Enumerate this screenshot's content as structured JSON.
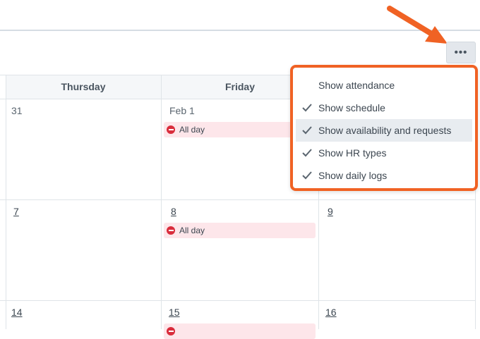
{
  "toolbar": {
    "more_label": "•••"
  },
  "calendar": {
    "headers": {
      "thursday": "Thursday",
      "friday": "Friday"
    },
    "rows": [
      {
        "thu": "31",
        "fri": "Feb 1"
      },
      {
        "thu": "7",
        "fri": "8",
        "sat": "9"
      },
      {
        "thu": "14",
        "fri": "15",
        "sat": "16"
      }
    ],
    "event_label": "All day"
  },
  "menu": {
    "items": [
      {
        "label": "Show attendance",
        "checked": false
      },
      {
        "label": "Show schedule",
        "checked": true
      },
      {
        "label": "Show availability and requests",
        "checked": true
      },
      {
        "label": "Show HR types",
        "checked": true
      },
      {
        "label": "Show daily logs",
        "checked": true
      }
    ]
  },
  "colors": {
    "highlight": "#f06224",
    "event_bg": "#fde6ea",
    "event_dot": "#d92d3c"
  }
}
